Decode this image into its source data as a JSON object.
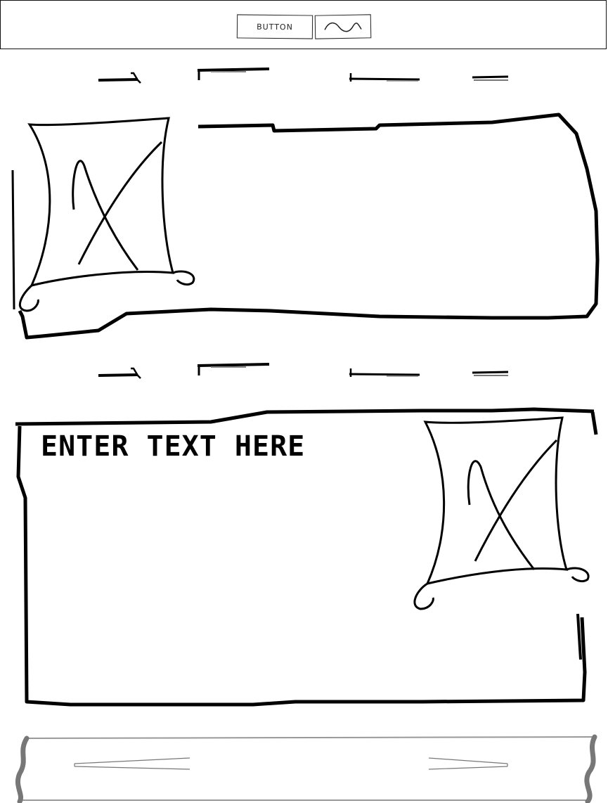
{
  "header": {
    "button_label": "BUTTON",
    "wave_icon": "squiggle-icon"
  },
  "nav_rows": [
    {
      "items": [
        "placeholder-line",
        "placeholder-line",
        "placeholder-line",
        "placeholder-line"
      ]
    },
    {
      "items": [
        "placeholder-line",
        "placeholder-line",
        "placeholder-line",
        "placeholder-line"
      ]
    }
  ],
  "card_one": {
    "image_icon": "image-placeholder-icon"
  },
  "card_two": {
    "text": "ENTER TEXT HERE",
    "image_icon": "image-placeholder-icon"
  },
  "footer": {
    "arrow_icons": [
      "left-arrow-icon",
      "right-arrow-icon"
    ]
  },
  "colors": {
    "stroke": "#000000",
    "background": "#ffffff",
    "footer_edge": "#9a9a9a"
  }
}
